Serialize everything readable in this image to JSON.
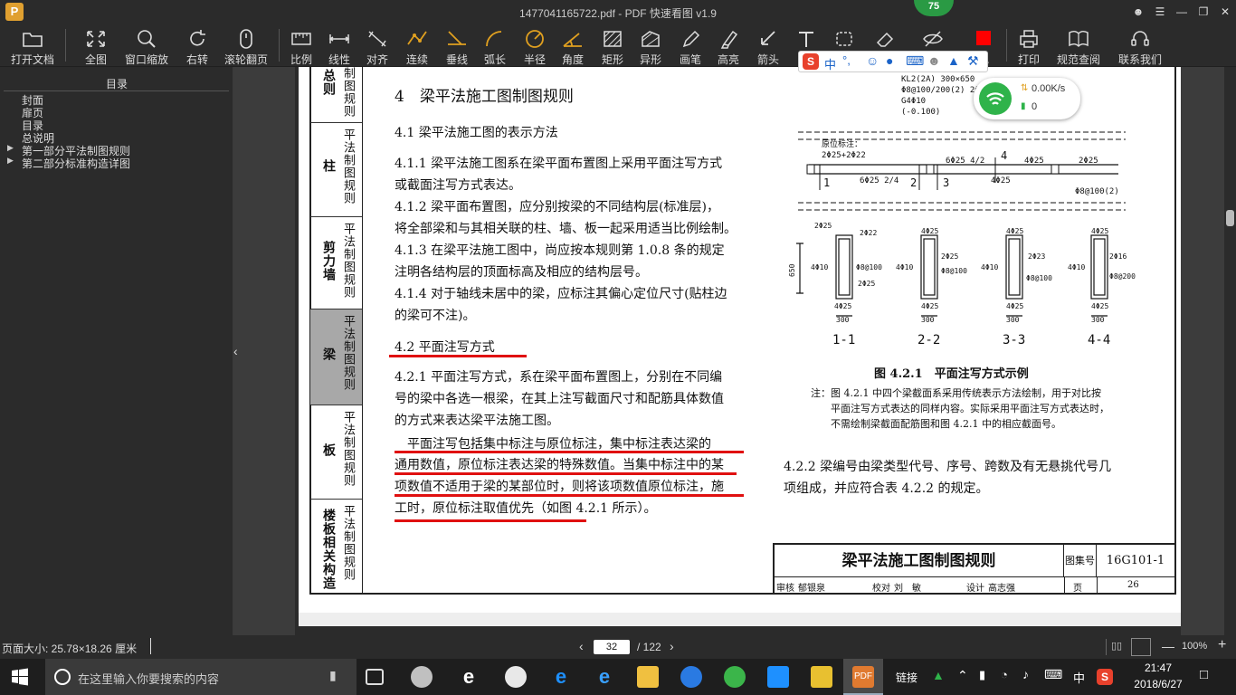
{
  "window": {
    "title": "1477041165722.pdf - PDF 快速看图 v1.9",
    "logo_text": "P",
    "badge": "75"
  },
  "toolbar": {
    "items": [
      "打开文档",
      "全图",
      "窗口缩放",
      "右转",
      "滚轮翻页",
      "比例",
      "线性",
      "对齐",
      "连续",
      "垂线",
      "弧长",
      "半径",
      "角度",
      "矩形",
      "异形",
      "画笔",
      "高亮",
      "箭头",
      "文",
      "",
      "",
      "",
      "",
      "色",
      "打印",
      "规范查阅",
      "联系我们"
    ]
  },
  "sidebar": {
    "title": "目录",
    "items": [
      {
        "label": "封面",
        "expandable": false
      },
      {
        "label": "扉页",
        "expandable": false
      },
      {
        "label": "目录",
        "expandable": false
      },
      {
        "label": "总说明",
        "expandable": false
      },
      {
        "label": "第一部分平法制图规则",
        "expandable": true
      },
      {
        "label": "第二部分标准构造详图",
        "expandable": true
      }
    ]
  },
  "document": {
    "side_tabs": [
      {
        "a": "总则",
        "b": "制图规则"
      },
      {
        "a": "柱",
        "b": "平法制图规则"
      },
      {
        "a": "剪力墙",
        "b": "平法制图规则"
      },
      {
        "a": "梁",
        "b": "平法制图规则"
      },
      {
        "a": "板",
        "b": "平法制图规则"
      },
      {
        "a": "楼板相关构造",
        "b": "平法制图规则"
      }
    ],
    "heading": "4　梁平法施工图制图规则",
    "sec41": "4.1  梁平法施工图的表示方法",
    "p411": [
      "4.1.1  梁平法施工图系在梁平面布置图上采用平面注写方式",
      "或截面注写方式表达。"
    ],
    "p412": [
      "4.1.2  梁平面布置图，应分别按梁的不同结构层(标准层)，",
      "将全部梁和与其相关联的柱、墙、板一起采用适当比例绘制。"
    ],
    "p413": [
      "4.1.3  在梁平法施工图中，尚应按本规则第 1.0.8 条的规定",
      "注明各结构层的顶面标高及相应的结构层号。"
    ],
    "p414": [
      "4.1.4  对于轴线未居中的梁，应标注其偏心定位尺寸(贴柱边",
      "的梁可不注)。"
    ],
    "sec42": "4.2  平面注写方式",
    "p421": [
      "4.2.1  平面注写方式，系在梁平面布置图上，分别在不同编",
      "号的梁中各选一根梁，在其上注写截面尺寸和配筋具体数值",
      "的方式来表达梁平法施工图。"
    ],
    "p421b": [
      "　平面注写包括集中标注与原位标注，集中标注表达梁的",
      "通用数值，原位标注表达梁的特殊数值。当集中标注中的某",
      "项数值不适用于梁的某部位时，则将该项数值原位标注，施",
      "工时，原位标注取值优先（如图 4.2.1 所示）。"
    ],
    "fig_caption": "图 4.2.1　平面注写方式示例",
    "fig_note": [
      "注：图 4.2.1 中四个梁截面系采用传统表示方法绘制，用于对比按",
      "　　平面注写方式表达的同样内容。实际采用平面注写方式表达时，",
      "　　不需绘制梁截面配筋图和图 4.2.1 中的相应截面号。"
    ],
    "p422": [
      "4.2.2  梁编号由梁类型代号、序号、跨数及有无悬挑代号几",
      "项组成，并应符合表 4.2.2 的规定。"
    ],
    "drawing": {
      "beam_label": [
        "KL2(2A)  300×650",
        "Φ8@100/200(2)  2Φ25",
        "G4Φ10",
        "(-0.100)"
      ],
      "orig_label": [
        "原位标注：",
        "2Φ25+2Φ22"
      ],
      "top_marks": [
        "6Φ25  4/2",
        "4Φ25",
        "2Φ25"
      ],
      "bottom_marks": [
        "6Φ25  2/4",
        "4Φ25",
        "Φ8@100(2)"
      ],
      "section_nums": [
        "1",
        "2",
        "3",
        "4"
      ],
      "sections": [
        "1-1",
        "2-2",
        "3-3",
        "4-4"
      ],
      "dim": "300",
      "height": "650",
      "rebar": [
        "2Φ25",
        "2Φ22",
        "4Φ10",
        "Φ8@100",
        "2Φ25",
        "4Φ25",
        "4Φ25",
        "4Φ10",
        "Φ8@100",
        "2Φ25",
        "4Φ25",
        "4Φ25",
        "4Φ10",
        "Φ8@100",
        "2Φ23",
        "4Φ25",
        "4Φ25",
        "4Φ10",
        "Φ8@200",
        "2Φ16",
        "4Φ25"
      ]
    },
    "title_block": {
      "title": "梁平法施工图制图规则",
      "atlas_label": "图集号",
      "atlas_no": "16G101-1",
      "row": [
        "审核",
        "郁银泉",
        "",
        "校对",
        "刘　敏",
        "",
        "设计",
        "高志强",
        "",
        "页",
        "26"
      ]
    }
  },
  "status": {
    "page_size": "页面大小: 25.78×18.26 厘米",
    "current_page": "32",
    "total_pages": "/ 122",
    "zoom": "100%"
  },
  "overlays": {
    "ime": "中",
    "net_speed": "0.00K/s",
    "net_count": "0"
  },
  "taskbar": {
    "search_placeholder": "在这里输入你要搜索的内容",
    "tray_label": "链接",
    "ime": "中",
    "time": "21:47",
    "date": "2018/6/27"
  }
}
